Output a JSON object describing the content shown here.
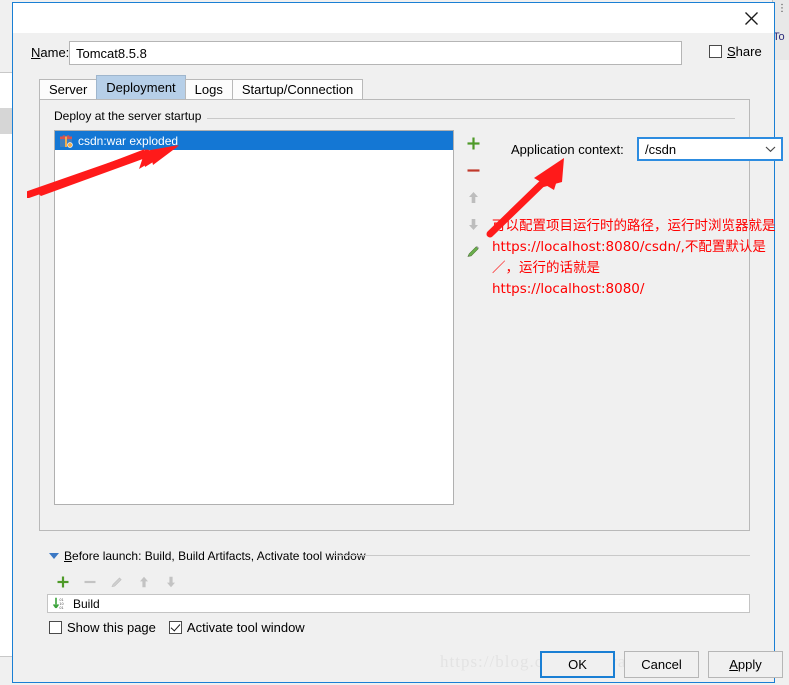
{
  "window": {
    "close_icon": "close-icon"
  },
  "background": {
    "right_tab_label": "To",
    "dots_icon": "kebab-menu-icon"
  },
  "name_row": {
    "label_prefix": "N",
    "label_rest": "ame:",
    "value": "Tomcat8.5.8",
    "placeholder": "Name",
    "share_prefix": "S",
    "share_rest": "hare",
    "share_checked": false
  },
  "tabs": [
    {
      "label": "Server",
      "selected": false
    },
    {
      "label": "Deployment",
      "selected": true
    },
    {
      "label": "Logs",
      "selected": false
    },
    {
      "label": "Startup/Connection",
      "selected": false
    }
  ],
  "deployment": {
    "group_title": "Deploy at the server startup",
    "items": [
      {
        "label": "csdn:war exploded",
        "icon": "artifact-package-icon",
        "selected": true
      }
    ],
    "toolbar": [
      {
        "name": "add-button",
        "icon": "plus-icon",
        "enabled": true
      },
      {
        "name": "remove-button",
        "icon": "minus-icon",
        "enabled": true
      },
      {
        "name": "move-up-button",
        "icon": "arrow-up-icon",
        "enabled": false
      },
      {
        "name": "move-down-button",
        "icon": "arrow-down-icon",
        "enabled": false
      },
      {
        "name": "edit-button",
        "icon": "pencil-icon",
        "enabled": true
      }
    ],
    "context_label": "Application context:",
    "context_value": "/csdn",
    "context_placeholder": "/csdn"
  },
  "annotation": {
    "text": "可以配置项目运行时的路径，运行时浏览器就是https://localhost:8080/csdn/,不配置默认是／，运行的话就是\nhttps://localhost:8080/",
    "color": "#ff0000"
  },
  "before_launch": {
    "title_prefix": "B",
    "title_rest": "efore launch: Build, Build Artifacts, Activate tool window",
    "toolbar": [
      {
        "name": "add-task-button",
        "icon": "plus-icon",
        "enabled": true
      },
      {
        "name": "remove-task-button",
        "icon": "minus-icon",
        "enabled": false
      },
      {
        "name": "edit-task-button",
        "icon": "pencil-icon",
        "enabled": false
      },
      {
        "name": "move-task-up-button",
        "icon": "arrow-up-icon",
        "enabled": false
      },
      {
        "name": "move-task-down-button",
        "icon": "arrow-down-icon",
        "enabled": false
      }
    ],
    "tasks": [
      {
        "label": "Build",
        "icon": "compile-icon"
      }
    ],
    "show_page_label": "Show this page",
    "show_page_checked": false,
    "activate_tool_window_label": "Activate tool window",
    "activate_tool_window_checked": true
  },
  "footer": {
    "watermark": "https://blog.csdn.net/wang1102",
    "ok_label": "OK",
    "cancel_label": "Cancel",
    "apply_prefix": "A",
    "apply_rest": "pply"
  },
  "colors": {
    "selection_blue": "#1477d4",
    "tab_selected": "#b6cfe8",
    "accent_focus": "#2d8ce0",
    "annotation_red": "#ff0000",
    "toolbar_green": "#4e9a28",
    "toolbar_red": "#c0392b"
  }
}
